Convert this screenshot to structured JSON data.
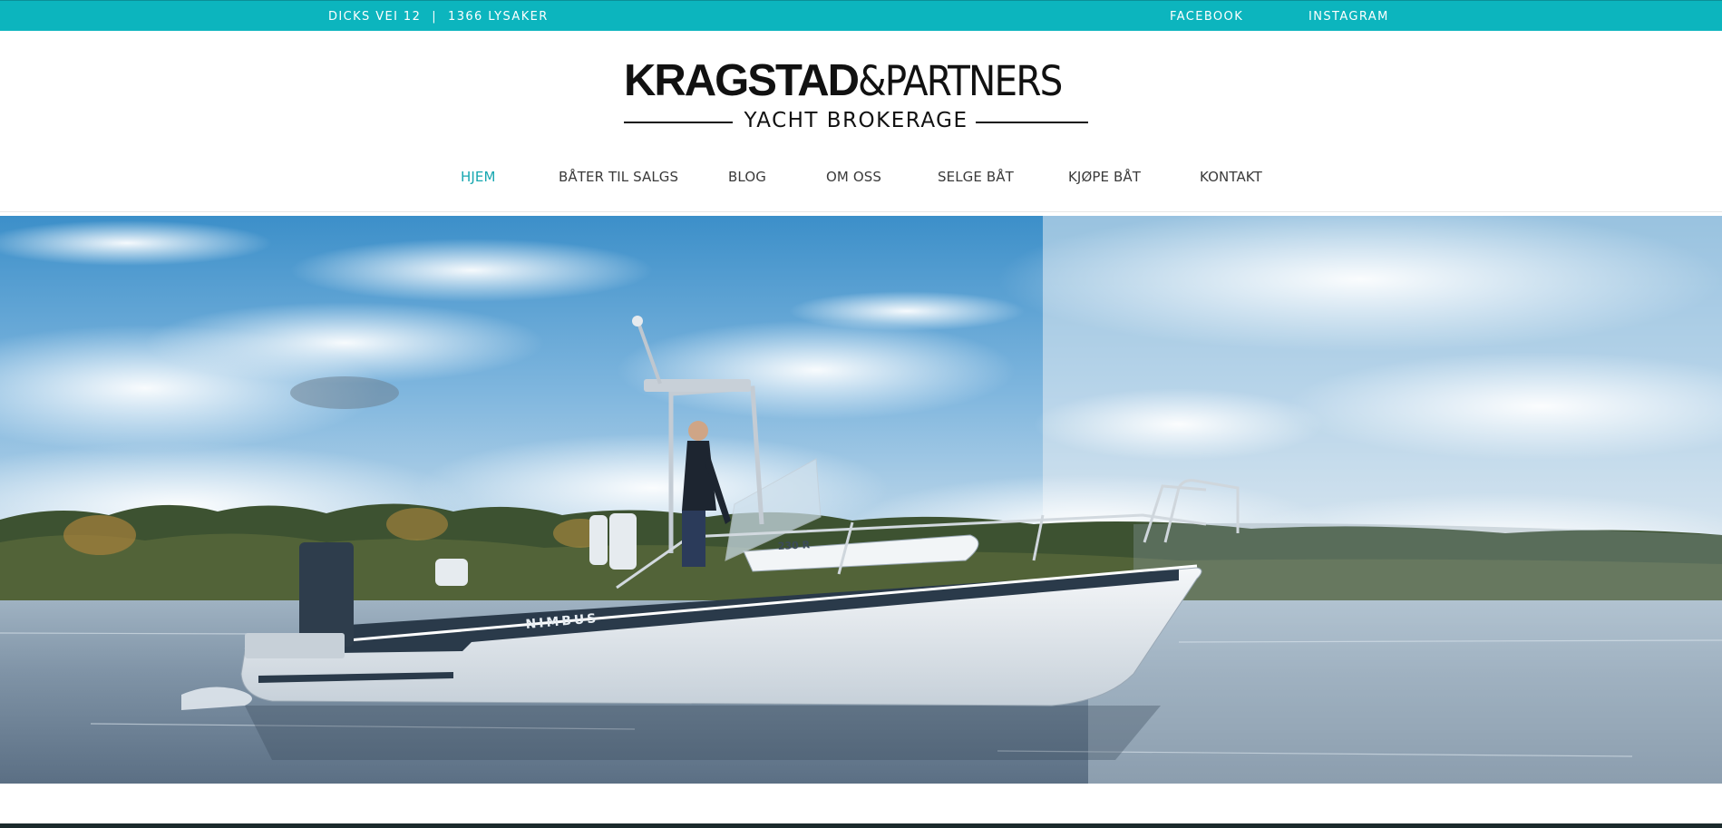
{
  "topbar": {
    "address_street": "DICKS VEI 12",
    "address_separator": "|",
    "address_city": "1366 LYSAKER",
    "facebook": "FACEBOOK",
    "instagram": "INSTAGRAM",
    "color": "#0cb5be"
  },
  "logo": {
    "name_bold": "KRAGSTAD",
    "name_light": "&PARTNERS",
    "tagline": "YACHT BROKERAGE"
  },
  "nav": {
    "items": [
      {
        "label": "HJEM",
        "active": true
      },
      {
        "label": "BÅTER TIL SALGS",
        "active": false
      },
      {
        "label": "BLOG",
        "active": false
      },
      {
        "label": "OM OSS",
        "active": false
      },
      {
        "label": "SELGE BÅT",
        "active": false
      },
      {
        "label": "KJØPE BÅT",
        "active": false
      },
      {
        "label": "KONTAKT",
        "active": false
      }
    ],
    "active_color": "#17a7b0"
  },
  "hero": {
    "boat_hull_text": "NIMBUS",
    "boat_model_text": "230 R"
  }
}
